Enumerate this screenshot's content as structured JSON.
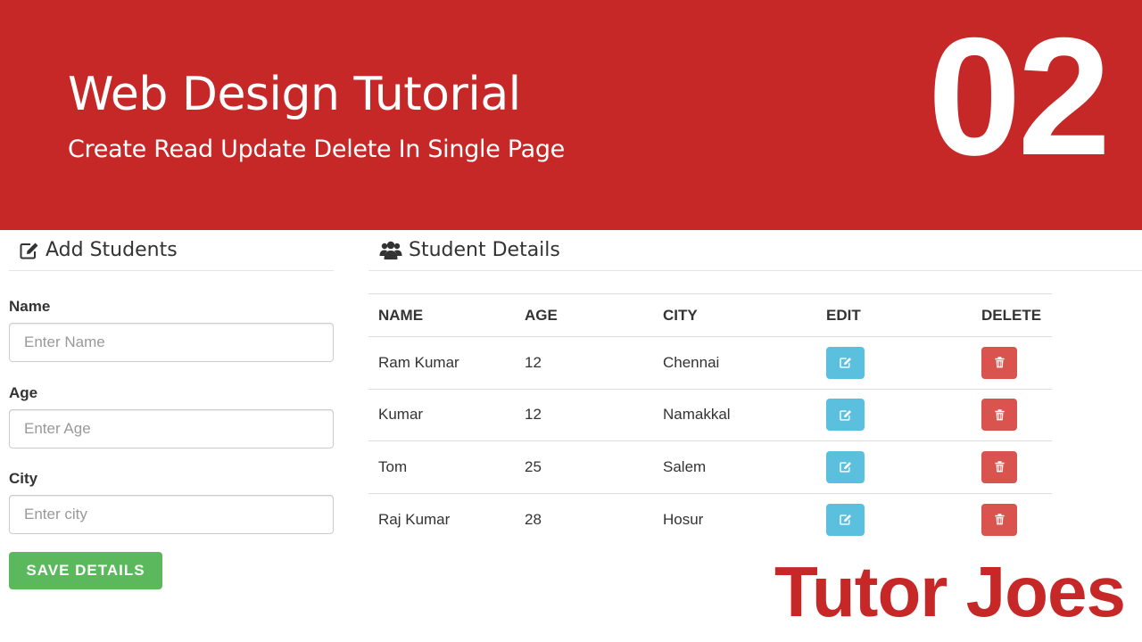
{
  "banner": {
    "title": "Web Design Tutorial",
    "subtitle": "Create Read Update Delete In Single Page",
    "number": "02"
  },
  "add_panel": {
    "title": "Add Students",
    "icon": "edit-icon",
    "fields": [
      {
        "label": "Name",
        "placeholder": "Enter Name",
        "value": ""
      },
      {
        "label": "Age",
        "placeholder": "Enter Age",
        "value": ""
      },
      {
        "label": "City",
        "placeholder": "Enter city",
        "value": ""
      }
    ],
    "save_label": "SAVE DETAILS"
  },
  "details_panel": {
    "title": "Student Details",
    "icon": "users-icon",
    "columns": [
      "NAME",
      "AGE",
      "CITY",
      "EDIT",
      "DELETE"
    ],
    "rows": [
      {
        "name": "Ram Kumar",
        "age": "12",
        "city": "Chennai"
      },
      {
        "name": "Kumar",
        "age": "12",
        "city": "Namakkal"
      },
      {
        "name": "Tom",
        "age": "25",
        "city": "Salem"
      },
      {
        "name": "Raj Kumar",
        "age": "28",
        "city": "Hosur"
      }
    ],
    "edit_icon": "edit-icon",
    "delete_icon": "trash-icon"
  },
  "brand": "Tutor Joes",
  "colors": {
    "banner": "#c62828",
    "save": "#5cb85c",
    "edit": "#5bc0de",
    "delete": "#d9534f"
  }
}
